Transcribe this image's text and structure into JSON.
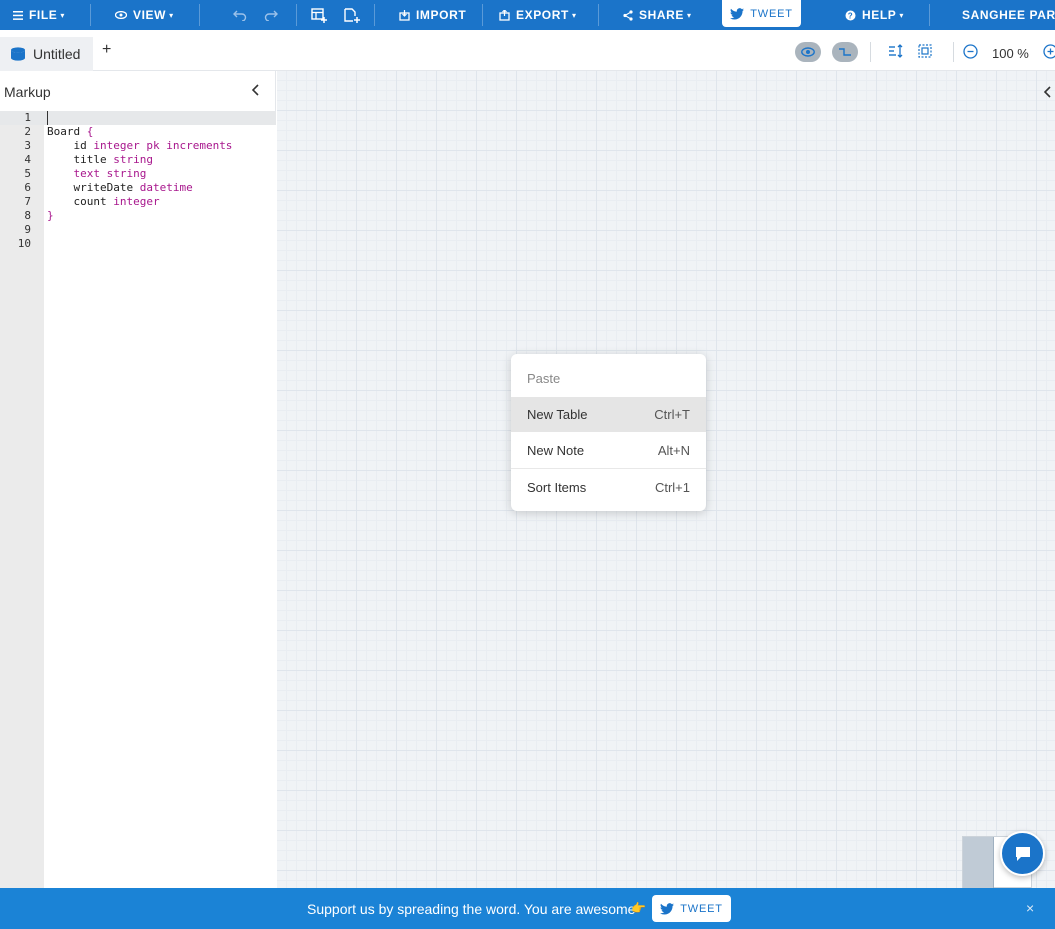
{
  "topbar": {
    "file_label": "FILE",
    "view_label": "VIEW",
    "import_label": "IMPORT",
    "export_label": "EXPORT",
    "share_label": "SHARE",
    "tweet_label": "TWEET",
    "help_label": "HELP",
    "user_name": "SANGHEE PARK"
  },
  "tabs": {
    "active_tab": "Untitled",
    "add_label": "+"
  },
  "zoom": {
    "level": "100 %"
  },
  "markup": {
    "title": "Markup",
    "line_numbers": [
      "1",
      "2",
      "3",
      "4",
      "5",
      "6",
      "7",
      "8",
      "9",
      "10"
    ]
  },
  "context_menu": {
    "items": [
      {
        "label": "Paste",
        "shortcut": ""
      },
      {
        "label": "New Table",
        "shortcut": "Ctrl+T"
      },
      {
        "label": "New Note",
        "shortcut": "Alt+N"
      },
      {
        "label": "Sort Items",
        "shortcut": "Ctrl+1"
      }
    ]
  },
  "banner": {
    "text": "Support us by spreading the word. You are awesome",
    "emoji": "👉",
    "tweet_label": "TWEET",
    "close_label": "×"
  },
  "colors": {
    "brand_blue": "#1b74c9",
    "keyword": "#a8178d"
  },
  "icons": [
    "menu-icon",
    "eye-icon",
    "undo-icon",
    "redo-icon",
    "add-table-icon",
    "add-note-icon",
    "import-icon",
    "export-icon",
    "share-icon",
    "twitter-icon",
    "help-icon",
    "database-icon",
    "view-toggle-icon",
    "connector-icon",
    "sort-icon",
    "fit-icon",
    "zoom-out-icon",
    "zoom-in-icon",
    "chevron-left-icon",
    "chat-icon",
    "close-icon"
  ]
}
